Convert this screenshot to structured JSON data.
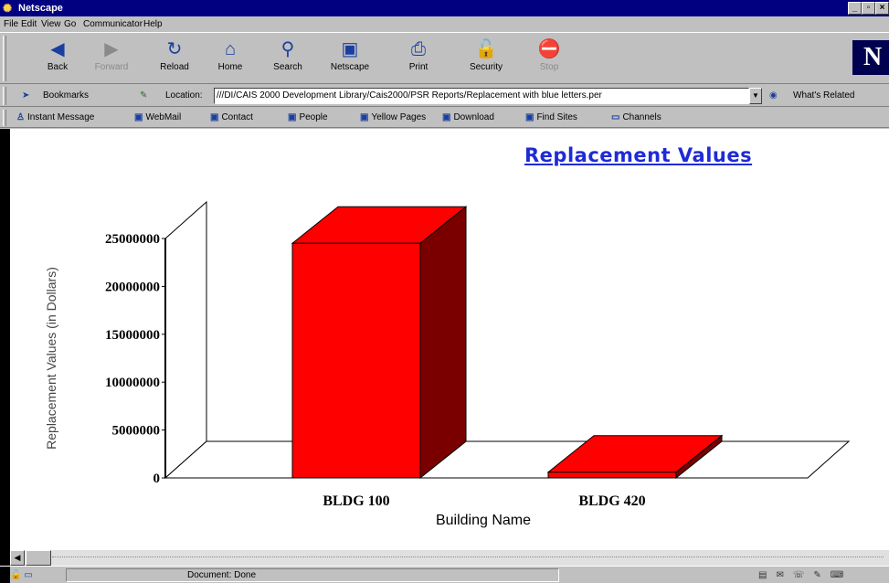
{
  "window": {
    "title": "Netscape",
    "minimize": "_",
    "maximize": "▫",
    "close": "×"
  },
  "menu": [
    "File",
    "Edit",
    "View",
    "Go",
    "Communicator",
    "Help"
  ],
  "toolbar": {
    "buttons": [
      {
        "label": "Back",
        "icon": "back-arrow-icon",
        "glyph": "◀",
        "enabled": true
      },
      {
        "label": "Forward",
        "icon": "forward-arrow-icon",
        "glyph": "▶",
        "enabled": false
      },
      {
        "label": "Reload",
        "icon": "reload-icon",
        "glyph": "↻",
        "enabled": true
      },
      {
        "label": "Home",
        "icon": "home-icon",
        "glyph": "⌂",
        "enabled": true
      },
      {
        "label": "Search",
        "icon": "search-icon",
        "glyph": "⚲",
        "enabled": true
      },
      {
        "label": "Netscape",
        "icon": "netscape-icon",
        "glyph": "▣",
        "enabled": true
      },
      {
        "label": "Print",
        "icon": "print-icon",
        "glyph": "⎙",
        "enabled": true
      },
      {
        "label": "Security",
        "icon": "security-lock-icon",
        "glyph": "🔓",
        "enabled": true
      },
      {
        "label": "Stop",
        "icon": "stop-icon",
        "glyph": "⛔",
        "enabled": false
      }
    ],
    "logo": "N"
  },
  "location_bar": {
    "bookmarks_label": "Bookmarks",
    "location_label": "Location:",
    "url": "///DI/CAIS 2000 Development Library/Cais2000/PSR Reports/Replacement with blue letters.per",
    "whats_related": "What's Related"
  },
  "personal_toolbar": [
    {
      "label": "Instant Message",
      "icon": "instant-message-icon"
    },
    {
      "label": "WebMail",
      "icon": "bookmark-page-icon"
    },
    {
      "label": "Contact",
      "icon": "bookmark-page-icon"
    },
    {
      "label": "People",
      "icon": "bookmark-page-icon"
    },
    {
      "label": "Yellow Pages",
      "icon": "bookmark-page-icon"
    },
    {
      "label": "Download",
      "icon": "bookmark-page-icon"
    },
    {
      "label": "Find Sites",
      "icon": "bookmark-page-icon"
    },
    {
      "label": "Channels",
      "icon": "channels-icon"
    }
  ],
  "chart_data": {
    "type": "bar",
    "title": "Replacement Values",
    "xlabel": "Building Name",
    "ylabel": "Replacement Values (in Dollars)",
    "categories": [
      "BLDG 100",
      "BLDG 420"
    ],
    "values": [
      24500000,
      600000
    ],
    "ylim": [
      0,
      25000000
    ],
    "yticks": [
      "0",
      "5000000",
      "10000000",
      "15000000",
      "20000000",
      "25000000"
    ],
    "grid": false,
    "bar_color": "#ff0000",
    "bar_side_color": "#7a0000"
  },
  "status": {
    "message": "Document: Done"
  }
}
